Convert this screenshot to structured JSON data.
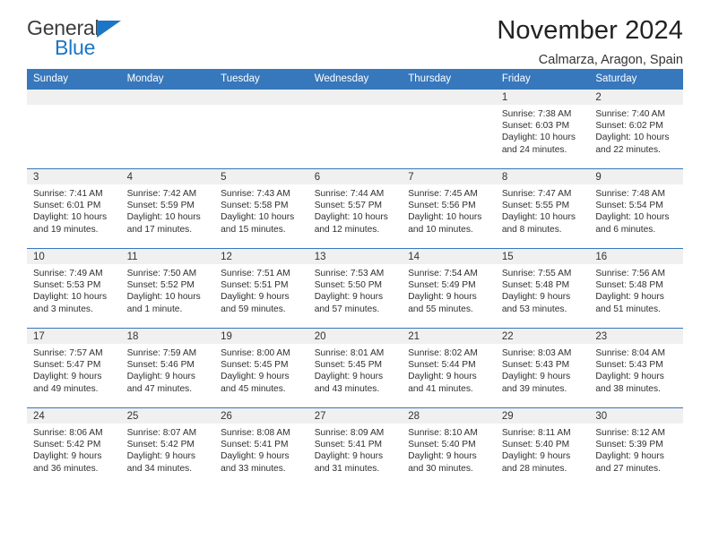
{
  "brand": {
    "name_part1": "General",
    "name_part2": "Blue"
  },
  "header": {
    "title": "November 2024",
    "location": "Calmarza, Aragon, Spain"
  },
  "colors": {
    "header_blue": "#3777bc",
    "brand_blue": "#1b76c6",
    "daynum_bg": "#f0f0f0"
  },
  "weekday_headers": [
    "Sunday",
    "Monday",
    "Tuesday",
    "Wednesday",
    "Thursday",
    "Friday",
    "Saturday"
  ],
  "weeks": [
    [
      {
        "day": "",
        "empty": true,
        "sunrise": "",
        "sunset": "",
        "daylight_line1": "",
        "daylight_line2": ""
      },
      {
        "day": "",
        "empty": true,
        "sunrise": "",
        "sunset": "",
        "daylight_line1": "",
        "daylight_line2": ""
      },
      {
        "day": "",
        "empty": true,
        "sunrise": "",
        "sunset": "",
        "daylight_line1": "",
        "daylight_line2": ""
      },
      {
        "day": "",
        "empty": true,
        "sunrise": "",
        "sunset": "",
        "daylight_line1": "",
        "daylight_line2": ""
      },
      {
        "day": "",
        "empty": true,
        "sunrise": "",
        "sunset": "",
        "daylight_line1": "",
        "daylight_line2": ""
      },
      {
        "day": "1",
        "sunrise": "Sunrise: 7:38 AM",
        "sunset": "Sunset: 6:03 PM",
        "daylight_line1": "Daylight: 10 hours",
        "daylight_line2": "and 24 minutes."
      },
      {
        "day": "2",
        "sunrise": "Sunrise: 7:40 AM",
        "sunset": "Sunset: 6:02 PM",
        "daylight_line1": "Daylight: 10 hours",
        "daylight_line2": "and 22 minutes."
      }
    ],
    [
      {
        "day": "3",
        "sunrise": "Sunrise: 7:41 AM",
        "sunset": "Sunset: 6:01 PM",
        "daylight_line1": "Daylight: 10 hours",
        "daylight_line2": "and 19 minutes."
      },
      {
        "day": "4",
        "sunrise": "Sunrise: 7:42 AM",
        "sunset": "Sunset: 5:59 PM",
        "daylight_line1": "Daylight: 10 hours",
        "daylight_line2": "and 17 minutes."
      },
      {
        "day": "5",
        "sunrise": "Sunrise: 7:43 AM",
        "sunset": "Sunset: 5:58 PM",
        "daylight_line1": "Daylight: 10 hours",
        "daylight_line2": "and 15 minutes."
      },
      {
        "day": "6",
        "sunrise": "Sunrise: 7:44 AM",
        "sunset": "Sunset: 5:57 PM",
        "daylight_line1": "Daylight: 10 hours",
        "daylight_line2": "and 12 minutes."
      },
      {
        "day": "7",
        "sunrise": "Sunrise: 7:45 AM",
        "sunset": "Sunset: 5:56 PM",
        "daylight_line1": "Daylight: 10 hours",
        "daylight_line2": "and 10 minutes."
      },
      {
        "day": "8",
        "sunrise": "Sunrise: 7:47 AM",
        "sunset": "Sunset: 5:55 PM",
        "daylight_line1": "Daylight: 10 hours",
        "daylight_line2": "and 8 minutes."
      },
      {
        "day": "9",
        "sunrise": "Sunrise: 7:48 AM",
        "sunset": "Sunset: 5:54 PM",
        "daylight_line1": "Daylight: 10 hours",
        "daylight_line2": "and 6 minutes."
      }
    ],
    [
      {
        "day": "10",
        "sunrise": "Sunrise: 7:49 AM",
        "sunset": "Sunset: 5:53 PM",
        "daylight_line1": "Daylight: 10 hours",
        "daylight_line2": "and 3 minutes."
      },
      {
        "day": "11",
        "sunrise": "Sunrise: 7:50 AM",
        "sunset": "Sunset: 5:52 PM",
        "daylight_line1": "Daylight: 10 hours",
        "daylight_line2": "and 1 minute."
      },
      {
        "day": "12",
        "sunrise": "Sunrise: 7:51 AM",
        "sunset": "Sunset: 5:51 PM",
        "daylight_line1": "Daylight: 9 hours",
        "daylight_line2": "and 59 minutes."
      },
      {
        "day": "13",
        "sunrise": "Sunrise: 7:53 AM",
        "sunset": "Sunset: 5:50 PM",
        "daylight_line1": "Daylight: 9 hours",
        "daylight_line2": "and 57 minutes."
      },
      {
        "day": "14",
        "sunrise": "Sunrise: 7:54 AM",
        "sunset": "Sunset: 5:49 PM",
        "daylight_line1": "Daylight: 9 hours",
        "daylight_line2": "and 55 minutes."
      },
      {
        "day": "15",
        "sunrise": "Sunrise: 7:55 AM",
        "sunset": "Sunset: 5:48 PM",
        "daylight_line1": "Daylight: 9 hours",
        "daylight_line2": "and 53 minutes."
      },
      {
        "day": "16",
        "sunrise": "Sunrise: 7:56 AM",
        "sunset": "Sunset: 5:48 PM",
        "daylight_line1": "Daylight: 9 hours",
        "daylight_line2": "and 51 minutes."
      }
    ],
    [
      {
        "day": "17",
        "sunrise": "Sunrise: 7:57 AM",
        "sunset": "Sunset: 5:47 PM",
        "daylight_line1": "Daylight: 9 hours",
        "daylight_line2": "and 49 minutes."
      },
      {
        "day": "18",
        "sunrise": "Sunrise: 7:59 AM",
        "sunset": "Sunset: 5:46 PM",
        "daylight_line1": "Daylight: 9 hours",
        "daylight_line2": "and 47 minutes."
      },
      {
        "day": "19",
        "sunrise": "Sunrise: 8:00 AM",
        "sunset": "Sunset: 5:45 PM",
        "daylight_line1": "Daylight: 9 hours",
        "daylight_line2": "and 45 minutes."
      },
      {
        "day": "20",
        "sunrise": "Sunrise: 8:01 AM",
        "sunset": "Sunset: 5:45 PM",
        "daylight_line1": "Daylight: 9 hours",
        "daylight_line2": "and 43 minutes."
      },
      {
        "day": "21",
        "sunrise": "Sunrise: 8:02 AM",
        "sunset": "Sunset: 5:44 PM",
        "daylight_line1": "Daylight: 9 hours",
        "daylight_line2": "and 41 minutes."
      },
      {
        "day": "22",
        "sunrise": "Sunrise: 8:03 AM",
        "sunset": "Sunset: 5:43 PM",
        "daylight_line1": "Daylight: 9 hours",
        "daylight_line2": "and 39 minutes."
      },
      {
        "day": "23",
        "sunrise": "Sunrise: 8:04 AM",
        "sunset": "Sunset: 5:43 PM",
        "daylight_line1": "Daylight: 9 hours",
        "daylight_line2": "and 38 minutes."
      }
    ],
    [
      {
        "day": "24",
        "sunrise": "Sunrise: 8:06 AM",
        "sunset": "Sunset: 5:42 PM",
        "daylight_line1": "Daylight: 9 hours",
        "daylight_line2": "and 36 minutes."
      },
      {
        "day": "25",
        "sunrise": "Sunrise: 8:07 AM",
        "sunset": "Sunset: 5:42 PM",
        "daylight_line1": "Daylight: 9 hours",
        "daylight_line2": "and 34 minutes."
      },
      {
        "day": "26",
        "sunrise": "Sunrise: 8:08 AM",
        "sunset": "Sunset: 5:41 PM",
        "daylight_line1": "Daylight: 9 hours",
        "daylight_line2": "and 33 minutes."
      },
      {
        "day": "27",
        "sunrise": "Sunrise: 8:09 AM",
        "sunset": "Sunset: 5:41 PM",
        "daylight_line1": "Daylight: 9 hours",
        "daylight_line2": "and 31 minutes."
      },
      {
        "day": "28",
        "sunrise": "Sunrise: 8:10 AM",
        "sunset": "Sunset: 5:40 PM",
        "daylight_line1": "Daylight: 9 hours",
        "daylight_line2": "and 30 minutes."
      },
      {
        "day": "29",
        "sunrise": "Sunrise: 8:11 AM",
        "sunset": "Sunset: 5:40 PM",
        "daylight_line1": "Daylight: 9 hours",
        "daylight_line2": "and 28 minutes."
      },
      {
        "day": "30",
        "sunrise": "Sunrise: 8:12 AM",
        "sunset": "Sunset: 5:39 PM",
        "daylight_line1": "Daylight: 9 hours",
        "daylight_line2": "and 27 minutes."
      }
    ]
  ]
}
